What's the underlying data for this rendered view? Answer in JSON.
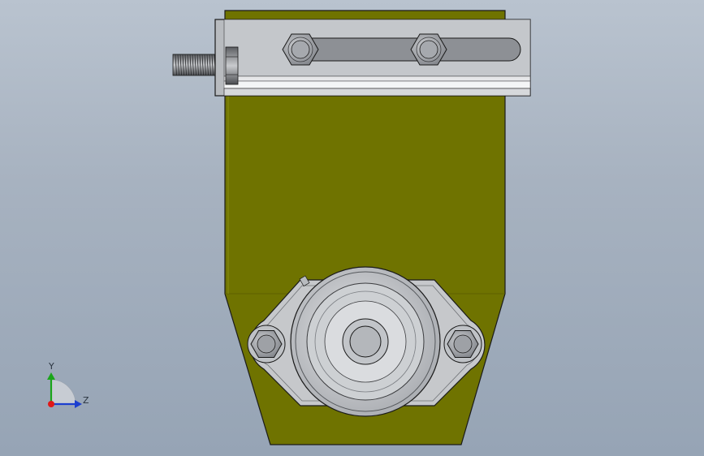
{
  "colors": {
    "background_top": "#b9c3cf",
    "background_bottom": "#96a4b5",
    "plate": "#6f7300",
    "plate_edge": "#2f3100",
    "steel": "#c8cacd",
    "steel_dark": "#8e9196",
    "outline": "#1a1a1a",
    "axis_x": "#e01818",
    "axis_y": "#1aa51a",
    "axis_z": "#1c3fcf"
  },
  "triad": {
    "y_label": "Y",
    "z_label": "Z"
  },
  "icons": {
    "triad": "view-orientation-triad-icon"
  }
}
